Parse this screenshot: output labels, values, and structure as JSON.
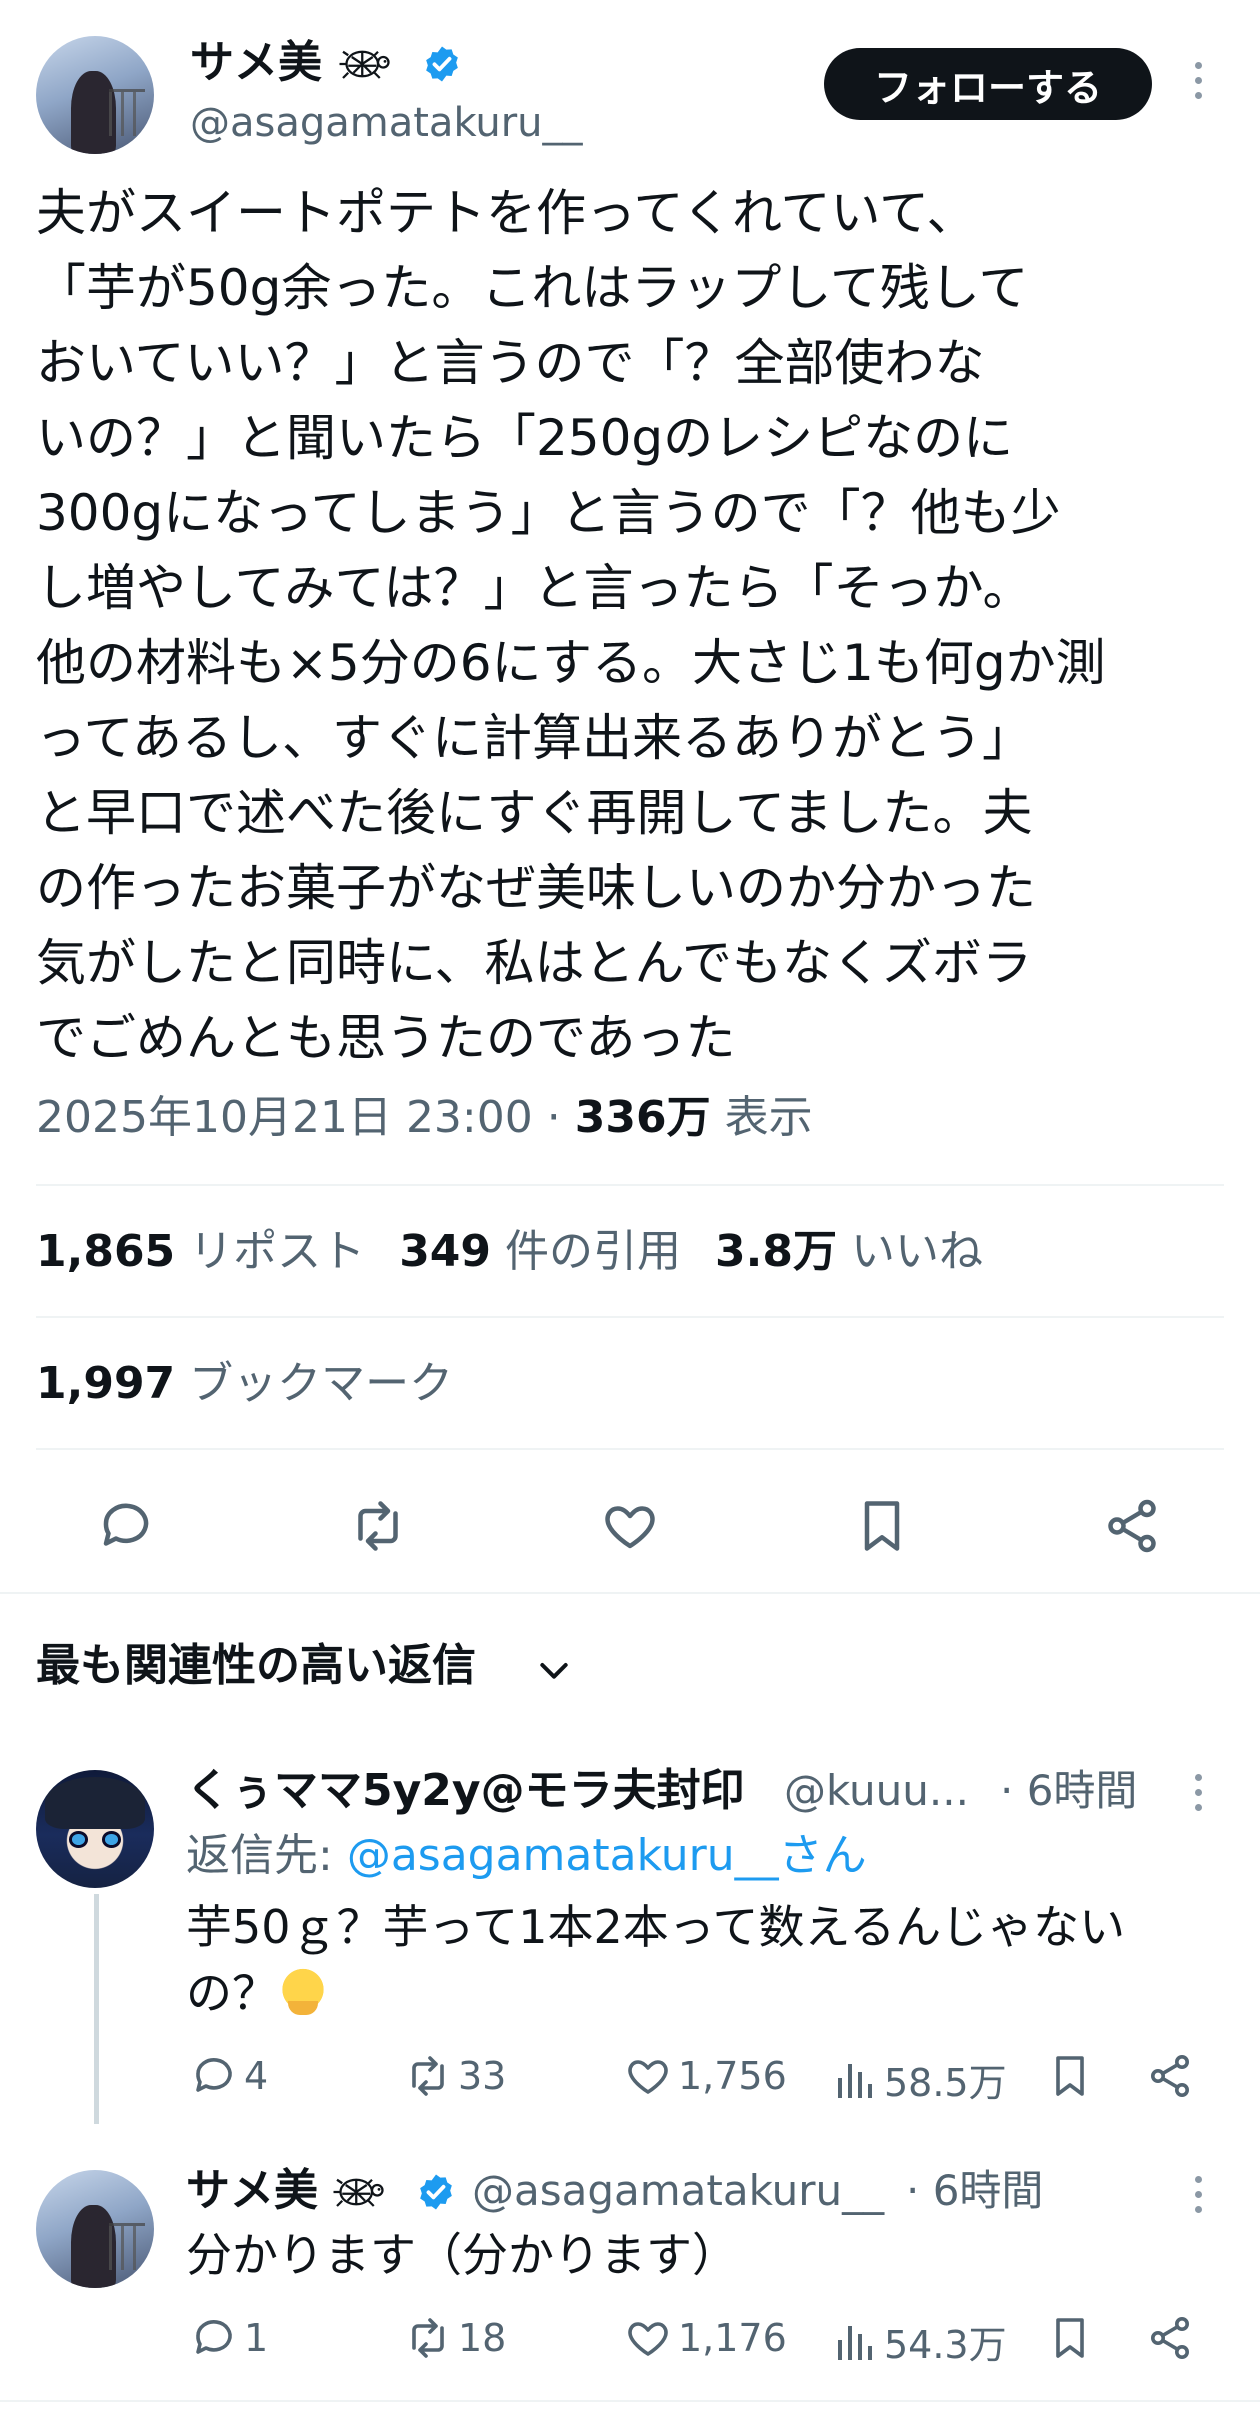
{
  "post": {
    "author_name": "サメ美",
    "author_handle": "@asagamatakuru__",
    "follow_label": "フォローする",
    "text": "夫がスイートポテトを作ってくれていて、\n「芋が50g余った。これはラップして残して\nおいていい？」と言うので「？全部使わな\nいの？」と聞いたら「250gのレシピなのに\n300gになってしまう」と言うので「？他も少\nし増やしてみては？」と言ったら「そっか。\n他の材料も×5分の6にする。大さじ1も何gか測\nってあるし、すぐに計算出来るありがとう」\nと早口で述べた後にすぐ再開してました。夫\nの作ったお菓子がなぜ美味しいのか分かった\n気がしたと同時に、私はとんでもなくズボラ\nでごめんとも思うたのであった",
    "timestamp": "2025年10月21日 23:00",
    "dot": " · ",
    "views_count": "336万",
    "views_label": " 表示",
    "reposts_count": "1,865",
    "reposts_label": " リポスト",
    "quotes_count": "349",
    "quotes_label": " 件の引用",
    "likes_count": "3.8万",
    "likes_label": " いいね",
    "bookmarks_count": "1,997",
    "bookmarks_label": " ブックマーク"
  },
  "replies_sort_label": "最も関連性の高い返信",
  "replies": [
    {
      "name": "くぅママ5y2y@モラ夫封印",
      "handle": "@kuuu...",
      "time": "· 6時間",
      "reply_to_prefix": "返信先: ",
      "reply_to_handle": "@asagamatakuru__さん",
      "text": "芋50ｇ？芋って1本2本って数えるんじゃない\nの？",
      "emoji": "melting-face-emoji",
      "stats": {
        "replies": "4",
        "reposts": "33",
        "likes": "1,756",
        "views": "58.5万"
      }
    },
    {
      "name": "サメ美",
      "handle": "@asagamatakuru__",
      "time": "· 6時間",
      "text": "分かります（分かります）",
      "stats": {
        "replies": "1",
        "reposts": "18",
        "likes": "1,176",
        "views": "54.3万"
      }
    }
  ],
  "icons": {
    "verified": "verified-badge-icon",
    "turtle": "turtle-emoji-icon",
    "more": "more-options-icon",
    "reply": "reply-icon",
    "repost": "repost-icon",
    "like": "heart-icon",
    "bookmark": "bookmark-icon",
    "share": "share-icon",
    "views": "views-bar-chart-icon",
    "chevron": "chevron-down-icon"
  },
  "colors": {
    "text": "#0f1419",
    "secondary": "#536471",
    "link": "#1d9bf0",
    "verified": "#1d9bf0",
    "button_bg": "#0f1419",
    "divider": "#eff3f4"
  }
}
